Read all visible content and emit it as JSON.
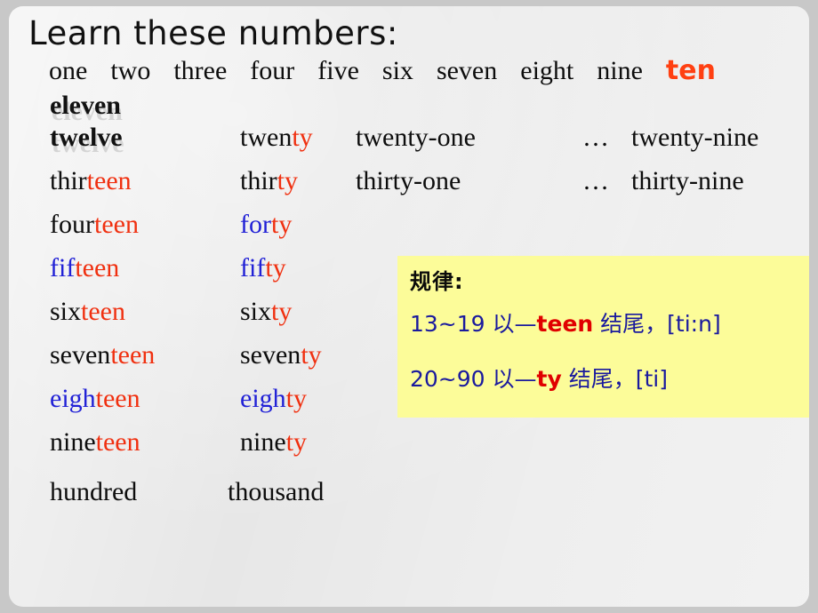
{
  "slide": {
    "title": "Learn these numbers:",
    "background_color": "#e7e7e7",
    "outer_color": "#c8c8c8"
  },
  "colors": {
    "black": "#0d0d0d",
    "red": "#F03010",
    "orange_red": "#FF4012",
    "blue": "#2121D6",
    "note_blue": "#1A1A9E",
    "note_red": "#E00000",
    "note_background": "#FCFC99"
  },
  "units_row": {
    "words": [
      "one",
      "two",
      "three",
      "four",
      "five",
      "six",
      "seven",
      "eight",
      "nine"
    ],
    "ten": "ten"
  },
  "teens_emphasis": {
    "eleven": "eleven",
    "twelve": "twelve"
  },
  "rows": [
    {
      "teen": {
        "stem": "",
        "suffix": "",
        "full": "twelve"
      },
      "ty": {
        "stem": "twen",
        "suffix": "ty"
      },
      "one": "twenty-one",
      "dots": "…",
      "nine": "twenty-nine"
    },
    {
      "teen": {
        "stem": "thir",
        "suffix": "teen"
      },
      "ty": {
        "stem": "thir",
        "suffix": "ty"
      },
      "one": "thirty-one",
      "dots": "…",
      "nine": "thirty-nine"
    },
    {
      "teen": {
        "stem": "four",
        "suffix": "teen"
      },
      "ty": {
        "stem": "for",
        "suffix": "ty"
      },
      "one": "",
      "dots": "",
      "nine": ""
    },
    {
      "teen": {
        "stem": "fif",
        "suffix": "teen"
      },
      "ty": {
        "stem": "fif",
        "suffix": "ty"
      },
      "one": "",
      "dots": "",
      "nine": ""
    },
    {
      "teen": {
        "stem": "six",
        "suffix": "teen"
      },
      "ty": {
        "stem": "six",
        "suffix": "ty"
      },
      "one": "",
      "dots": "",
      "nine": ""
    },
    {
      "teen": {
        "stem": "seven",
        "suffix": "teen"
      },
      "ty": {
        "stem": "seven",
        "suffix": "ty"
      },
      "one": "",
      "dots": "",
      "nine": ""
    },
    {
      "teen": {
        "stem": "eigh",
        "suffix": "teen"
      },
      "ty": {
        "stem": "eigh",
        "suffix": "ty"
      },
      "one": "",
      "dots": "",
      "nine": ""
    },
    {
      "teen": {
        "stem": "nine",
        "suffix": "teen"
      },
      "ty": {
        "stem": "nine",
        "suffix": "ty"
      },
      "one": "",
      "dots": "",
      "nine": ""
    }
  ],
  "big_numbers": {
    "hundred": "hundred",
    "thousand": "thousand"
  },
  "note": {
    "title": "规律:",
    "rule_teen": {
      "range": "13~19 ",
      "pre": "以—",
      "suffix": "teen",
      "post": " 结尾，",
      "phonetic": "[ti:n]"
    },
    "rule_ty": {
      "range": "20~90 ",
      "pre": "以—",
      "suffix": "ty",
      "post": " 结尾，",
      "phonetic": "[ti]"
    }
  }
}
